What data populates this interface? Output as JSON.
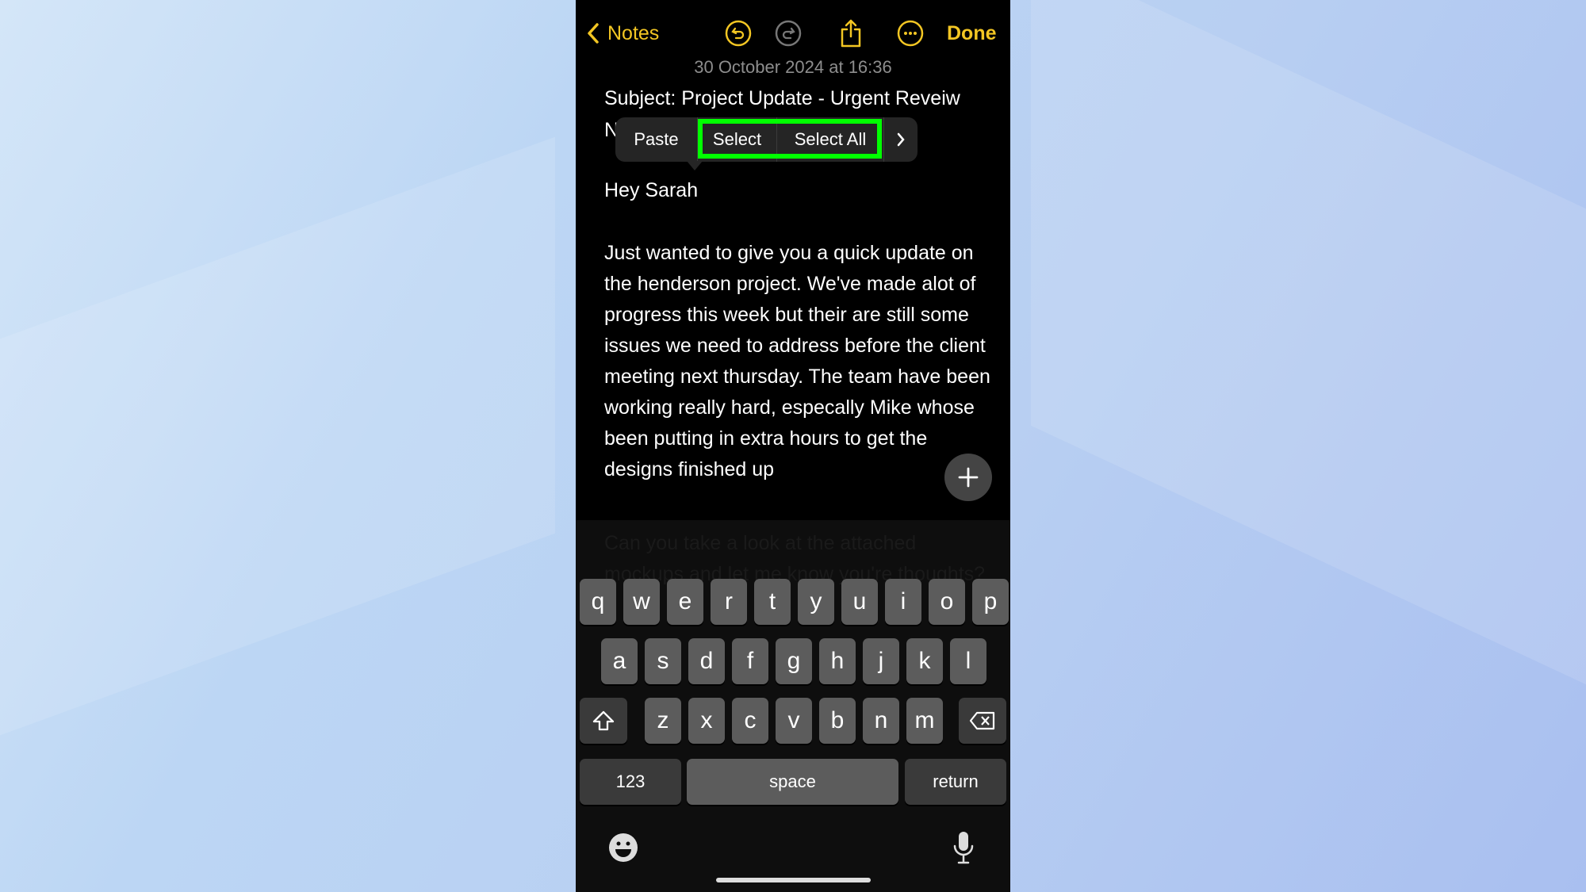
{
  "nav": {
    "back_label": "Notes",
    "done_label": "Done",
    "icons": [
      "chevron-left-icon",
      "undo-icon",
      "redo-icon",
      "share-icon",
      "more-icon"
    ]
  },
  "note": {
    "date": "30 October 2024 at 16:36",
    "subject": "Subject: Project Update - Urgent Reveiw",
    "hidden_line_start": "N",
    "greeting": "Hey Sarah",
    "body": [
      "Just wanted to give you a quick update on",
      "the henderson project. We've made alot of",
      "progress this week but their are still some",
      "issues we need to address before the client",
      "meeting next thursday. The team have been",
      "working really hard, especally Mike whose",
      "been putting in extra hours to get the",
      "designs finished up"
    ],
    "obscured": [
      "Can you take a look at the attached",
      "mockups and let me know you're thoughts?"
    ]
  },
  "context_menu": {
    "items": [
      "Paste",
      "Select",
      "Select All"
    ],
    "more_icon": "chevron-right-icon",
    "highlight_color": "#00ff00"
  },
  "keyboard": {
    "row1": [
      "q",
      "w",
      "e",
      "r",
      "t",
      "y",
      "u",
      "i",
      "o",
      "p"
    ],
    "row2": [
      "a",
      "s",
      "d",
      "f",
      "g",
      "h",
      "j",
      "k",
      "l"
    ],
    "row3": [
      "z",
      "x",
      "c",
      "v",
      "b",
      "n",
      "m"
    ],
    "numbers": "123",
    "space": "space",
    "return": "return"
  },
  "colors": {
    "accent": "#f3c623"
  }
}
